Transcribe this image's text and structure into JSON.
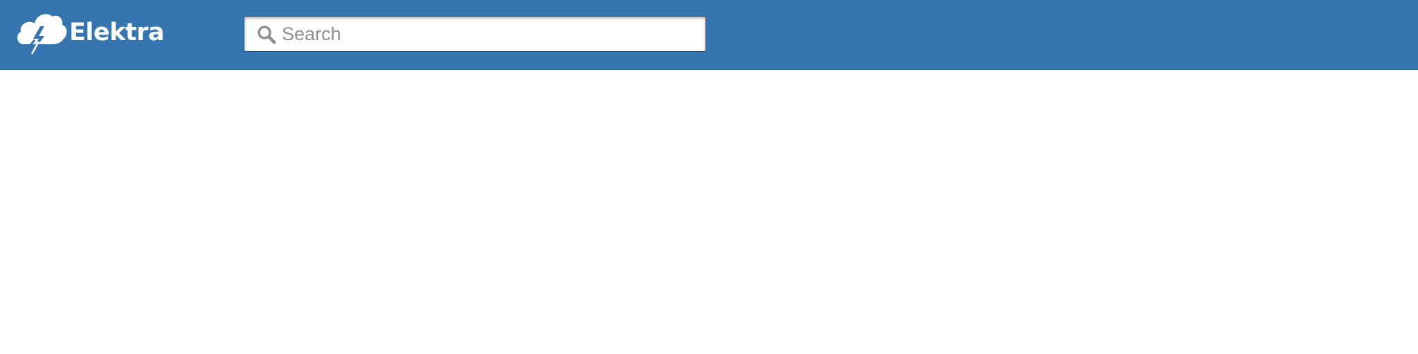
{
  "header": {
    "brand_name": "Elektra",
    "logo_icon": "cloud-lightning-icon",
    "background_color": "#3676b0"
  },
  "search": {
    "placeholder": "Search",
    "value": "",
    "icon": "search-icon"
  }
}
